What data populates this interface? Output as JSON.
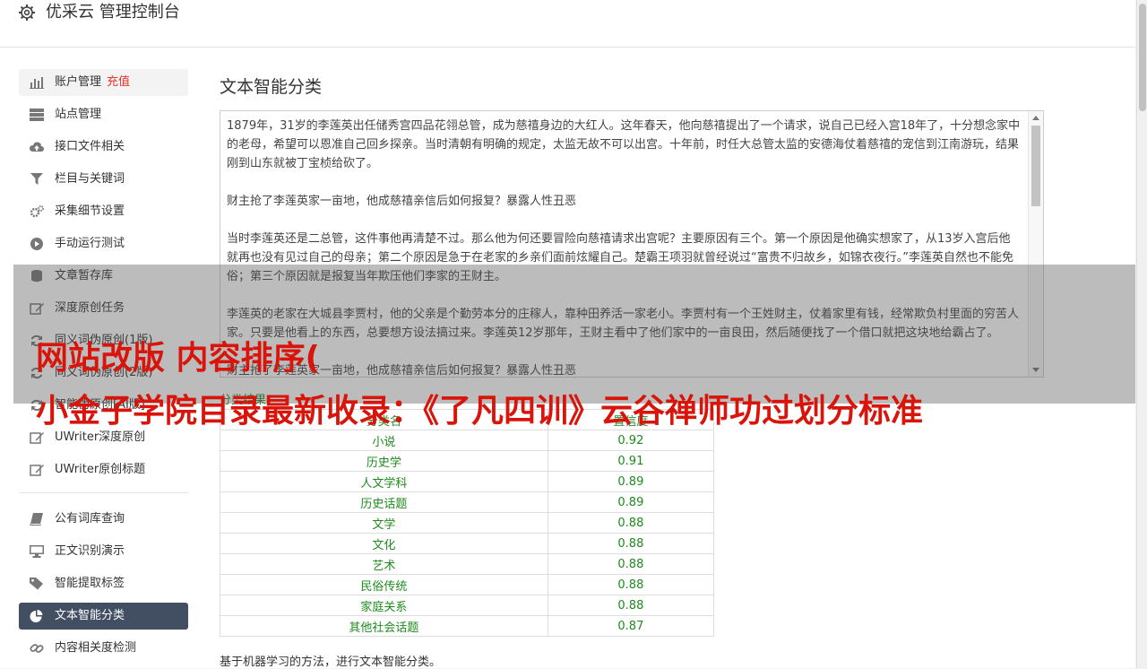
{
  "header": {
    "title": "优采云 管理控制台",
    "icon": "gear-icon"
  },
  "sidebar": {
    "group1": [
      {
        "label": "账户管理",
        "badge": "充值",
        "icon": "bar-chart-icon"
      },
      {
        "label": "站点管理",
        "icon": "server-icon"
      },
      {
        "label": "接口文件相关",
        "icon": "cloud-upload-icon"
      },
      {
        "label": "栏目与关键词",
        "icon": "filter-icon"
      },
      {
        "label": "采集细节设置",
        "icon": "gears-icon"
      },
      {
        "label": "手动运行测试",
        "icon": "play-circle-icon"
      },
      {
        "label": "文章暂存库",
        "icon": "database-icon"
      },
      {
        "label": "深度原创任务",
        "icon": "edit-icon"
      },
      {
        "label": "同义词伪原创(1版)",
        "icon": "refresh-icon"
      },
      {
        "label": "同义词伪原创(2版)",
        "icon": "refresh-icon"
      },
      {
        "label": "智能伪原创[AI版]",
        "icon": "refresh-icon"
      },
      {
        "label": "UWriter深度原创",
        "icon": "edit-icon"
      },
      {
        "label": "UWriter原创标题",
        "icon": "edit-icon"
      }
    ],
    "group2": [
      {
        "label": "公有词库查询",
        "icon": "book-icon"
      },
      {
        "label": "正文识别演示",
        "icon": "monitor-icon"
      },
      {
        "label": "智能提取标签",
        "icon": "tag-icon"
      },
      {
        "label": "文本智能分类",
        "icon": "pie-chart-icon"
      },
      {
        "label": "内容相关度检测",
        "icon": "link-icon"
      }
    ]
  },
  "main": {
    "title": "文本智能分类",
    "text": "1879年，31岁的李莲英出任储秀宫四品花翎总管，成为慈禧身边的大红人。这年春天，他向慈禧提出了一个请求，说自己已经入宫18年了，十分想念家中的老母，希望可以恩准自己回乡探亲。当时清朝有明确的规定，太监无故不可以出宫。十年前，时任大总管太监的安德海仗着慈禧的宠信到江南游玩，结果刚到山东就被丁宝桢给砍了。\n\n财主抢了李莲英家一亩地，他成慈禧亲信后如何报复？暴露人性丑恶\n\n当时李莲英还是二总管，这件事他再清楚不过。那么他为何还要冒险向慈禧请求出宫呢？主要原因有三个。第一个原因是他确实想家了，从13岁入宫后他就再也没有见过自己的母亲；第二个原因是急于在老家的乡亲们面前炫耀自己。楚霸王项羽就曾经说过“富贵不归故乡，如锦衣夜行。”李莲英自然也不能免俗；第三个原因就是报复当年欺压他们李家的王财主。\n\n李莲英的老家在大城县李贾村，他的父亲是个勤劳本分的庄稼人，靠种田养活一家老小。李贾村有一个王姓财主，仗着家里有钱，经常欺负村里面的穷苦人家。只要是他看上的东西，总要想方设法搞过来。李莲英12岁那年，王财主看中了他们家中的一亩良田，然后随便找了一个借口就把这块地给霸占了。\n\n财主抢了李莲英家一亩地，他成慈禧亲信后如何报复？暴露人性丑恶",
    "result_label": "分类结果",
    "table": {
      "headers": [
        "分类名",
        "置信度"
      ],
      "rows": [
        [
          "小说",
          "0.92"
        ],
        [
          "历史学",
          "0.91"
        ],
        [
          "人文学科",
          "0.89"
        ],
        [
          "历史话题",
          "0.89"
        ],
        [
          "文学",
          "0.88"
        ],
        [
          "文化",
          "0.88"
        ],
        [
          "艺术",
          "0.88"
        ],
        [
          "民俗传统",
          "0.88"
        ],
        [
          "家庭关系",
          "0.88"
        ],
        [
          "其他社会话题",
          "0.87"
        ]
      ]
    },
    "footnote": "基于机器学习的方法，进行文本智能分类。"
  },
  "overlay": {
    "line1": "网站改版 内容排序(",
    "line2": "小金子学院目录最新收录：《了凡四训》云谷禅师功过划分标准"
  },
  "colors": {
    "active_bg": "#424f63",
    "accent_red": "#e6322b",
    "result_green": "#1d8a1d",
    "overlay_red": "#d9140a"
  }
}
